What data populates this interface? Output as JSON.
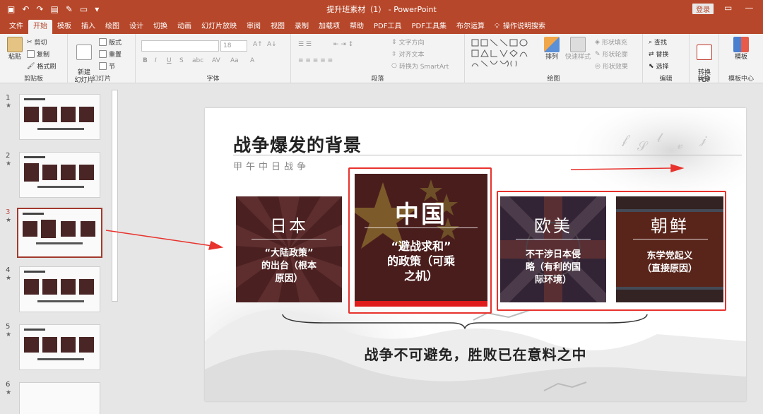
{
  "titlebar": {
    "doc_title": "提升班素材（1） - PowerPoint",
    "login_label": "登录",
    "window_controls": [
      "▭",
      "—"
    ]
  },
  "tabs": [
    {
      "label": "文件",
      "active": false
    },
    {
      "label": "开始",
      "active": true
    },
    {
      "label": "模板",
      "active": false
    },
    {
      "label": "插入",
      "active": false
    },
    {
      "label": "绘图",
      "active": false
    },
    {
      "label": "设计",
      "active": false
    },
    {
      "label": "切换",
      "active": false
    },
    {
      "label": "动画",
      "active": false
    },
    {
      "label": "幻灯片放映",
      "active": false
    },
    {
      "label": "审阅",
      "active": false
    },
    {
      "label": "视图",
      "active": false
    },
    {
      "label": "录制",
      "active": false
    },
    {
      "label": "加载项",
      "active": false
    },
    {
      "label": "帮助",
      "active": false
    },
    {
      "label": "PDF工具",
      "active": false
    },
    {
      "label": "PDF工具集",
      "active": false
    },
    {
      "label": "布尔运算",
      "active": false
    }
  ],
  "tell_me": "操作说明搜索",
  "ribbon": {
    "clipboard": {
      "paste": "粘贴",
      "cut": "剪切",
      "copy": "复制",
      "format_painter": "格式刷",
      "label": "剪贴板"
    },
    "slides": {
      "new_slide": "新建\n幻灯片",
      "layout": "版式",
      "reset": "重置",
      "section": "节",
      "label": "幻灯片"
    },
    "font": {
      "size": "18",
      "label": "字体"
    },
    "paragraph": {
      "text_direction": "文字方向",
      "align_text": "对齐文本",
      "smartart": "转换为 SmartArt",
      "label": "段落"
    },
    "drawing": {
      "arrange": "排列",
      "quick_styles": "快速样式",
      "shape_fill": "形状填充",
      "shape_outline": "形状轮廓",
      "shape_effects": "形状效果",
      "label": "绘图"
    },
    "editing": {
      "find": "查找",
      "replace": "替换",
      "select": "选择",
      "label": "编辑"
    },
    "convert": {
      "to_pdf": "转换\nPDF",
      "label": "转换"
    },
    "template": {
      "template": "模板",
      "label": "模板中心"
    }
  },
  "thumbnails": [
    {
      "num": "1",
      "selected": false
    },
    {
      "num": "2",
      "selected": false
    },
    {
      "num": "3",
      "selected": true
    },
    {
      "num": "4",
      "selected": false
    },
    {
      "num": "5",
      "selected": false
    },
    {
      "num": "6",
      "selected": false
    }
  ],
  "slide": {
    "title": "战争爆发的背景",
    "subtitle": "甲午中日战争",
    "cards": [
      {
        "title": "日本",
        "desc": "“大陆政策”\n的出台（根本\n原因）"
      },
      {
        "title": "中国",
        "desc": "“避战求和”\n的政策（可乘\n之机）"
      },
      {
        "title": "欧美",
        "desc": "不干涉日本侵\n略（有利的国\n际环境）"
      },
      {
        "title": "朝鲜",
        "desc": "东学党起义\n（直接原因）"
      }
    ],
    "bottom_text": "战争不可避免，胜败已在意料之中"
  },
  "colors": {
    "accent": "#b7472a",
    "annotation_red": "#e8322d",
    "card_dark": "#4a1e1e"
  }
}
